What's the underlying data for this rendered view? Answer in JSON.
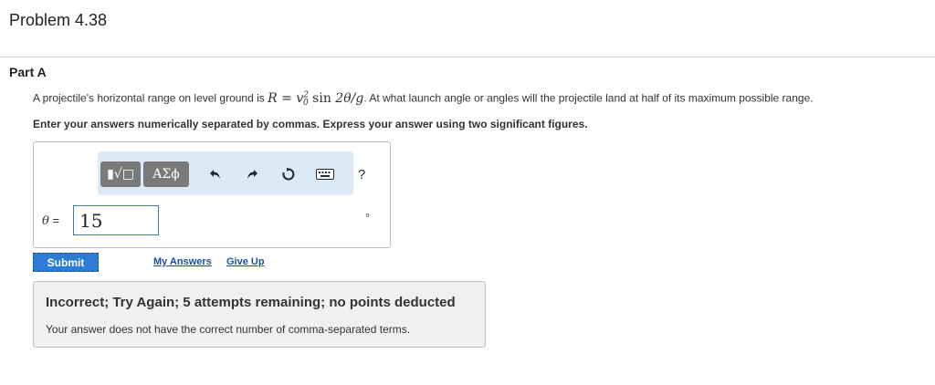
{
  "problem": {
    "title": "Problem 4.38"
  },
  "part": {
    "title": "Part A",
    "question_prefix": "A projectile's horizontal range on level ground is",
    "formula": {
      "lhs": "R",
      "eq": "=",
      "v": "v",
      "sup": "2",
      "sub": "0",
      "func": "sin",
      "arg": "2θ/g"
    },
    "question_suffix": ". At what launch angle or angles will the projectile land at half of its maximum possible range.",
    "instructions": "Enter your answers numerically separated by commas. Express your answer using two significant figures."
  },
  "toolbar": {
    "templates_label": "▮√□",
    "symbols_label": "ΑΣϕ",
    "undo_glyph": "↶",
    "redo_glyph": "↷",
    "reset_glyph": "↻",
    "help_label": "?"
  },
  "answer": {
    "variable": "θ",
    "equals": "=",
    "value": "15",
    "unit": "°"
  },
  "actions": {
    "submit_label": "Submit",
    "my_answers_label": "My Answers",
    "give_up_label": "Give Up"
  },
  "feedback": {
    "title": "Incorrect; Try Again; 5 attempts remaining; no points deducted",
    "message": "Your answer does not have the correct number of comma-separated terms."
  },
  "colors": {
    "submit_bg": "#2d7bd3",
    "toolbar_bg": "#dce9f7",
    "link": "#1a4e9e",
    "feedback_bg": "#f0f0f0"
  }
}
